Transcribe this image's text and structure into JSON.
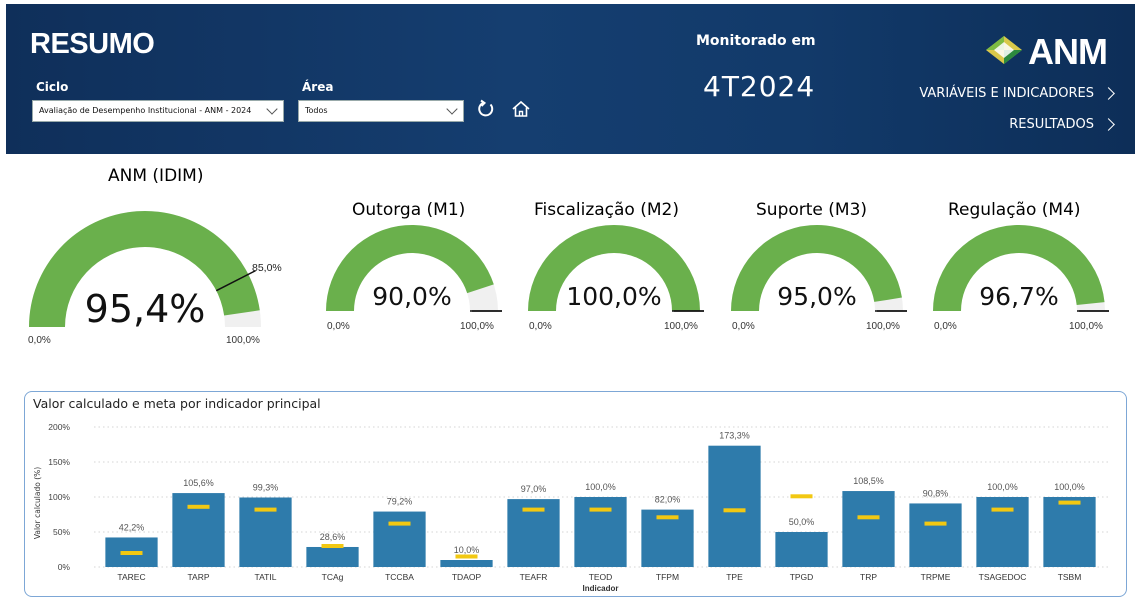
{
  "header": {
    "title": "RESUMO",
    "ciclo_label": "Ciclo",
    "ciclo_value": "Avaliação de Desempenho Institucional - ANM - 2024",
    "area_label": "Área",
    "area_value": "Todos",
    "monitorado_label": "Monitorado em",
    "monitorado_value": "4T2024",
    "logo_text": "ANM",
    "nav_variaveis": "VARIÁVEIS E INDICADORES",
    "nav_resultados": "RESULTADOS",
    "icons": [
      "refresh-icon",
      "home-icon",
      "chevron-down-icon",
      "chevron-right-icon"
    ]
  },
  "gauges": [
    {
      "id": "idim",
      "title": "ANM (IDIM)",
      "value": 95.4,
      "value_label": "95,4%",
      "target": 85.0,
      "target_label": "85,0%",
      "min_label": "0,0%",
      "max_label": "100,0%"
    },
    {
      "id": "m1",
      "title": "Outorga (M1)",
      "value": 90.0,
      "value_label": "90,0%",
      "target": 100.0,
      "min_label": "0,0%",
      "max_label": "100,0%"
    },
    {
      "id": "m2",
      "title": "Fiscalização (M2)",
      "value": 100.0,
      "value_label": "100,0%",
      "target": 100.0,
      "min_label": "0,0%",
      "max_label": "100,0%"
    },
    {
      "id": "m3",
      "title": "Suporte (M3)",
      "value": 95.0,
      "value_label": "95,0%",
      "target": 100.0,
      "min_label": "0,0%",
      "max_label": "100,0%"
    },
    {
      "id": "m4",
      "title": "Regulação (M4)",
      "value": 96.7,
      "value_label": "96,7%",
      "target": 100.0,
      "min_label": "0,0%",
      "max_label": "100,0%"
    }
  ],
  "colors": {
    "gauge_fill": "#6ab04c",
    "gauge_empty": "#f0f0f0",
    "bar": "#2e7bab",
    "meta": "#f2c812",
    "header_bg": "#133a6a"
  },
  "chart_data": {
    "type": "bar",
    "title": "Valor calculado e meta por indicador principal",
    "xlabel": "Indicador",
    "ylabel": "Valor calculado (%)",
    "ylim": [
      0,
      200
    ],
    "yticks": [
      "0%",
      "50%",
      "100%",
      "150%",
      "200%"
    ],
    "categories": [
      "TAREC",
      "TARP",
      "TATIL",
      "TCAg",
      "TCCBA",
      "TDAOP",
      "TEAFR",
      "TEOD",
      "TFPM",
      "TPE",
      "TPGD",
      "TRP",
      "TRPME",
      "TSAGEDOC",
      "TSBM"
    ],
    "series": [
      {
        "values": [
          42.2,
          105.6,
          99.3,
          28.6,
          79.2,
          10.0,
          97.0,
          100.0,
          82.0,
          173.3,
          50.0,
          108.5,
          90.8,
          100.0,
          100.0
        ],
        "labels": [
          "42,2%",
          "105,6%",
          "99,3%",
          "28,6%",
          "79,2%",
          "10,0%",
          "97,0%",
          "100,0%",
          "82,0%",
          "173,3%",
          "50,0%",
          "108,5%",
          "90,8%",
          "100,0%",
          "100,0%"
        ]
      },
      {
        "values": [
          20,
          86,
          82,
          30,
          62,
          15,
          82,
          82,
          71,
          81,
          101,
          71,
          62,
          82,
          92
        ]
      }
    ],
    "grid": true
  }
}
